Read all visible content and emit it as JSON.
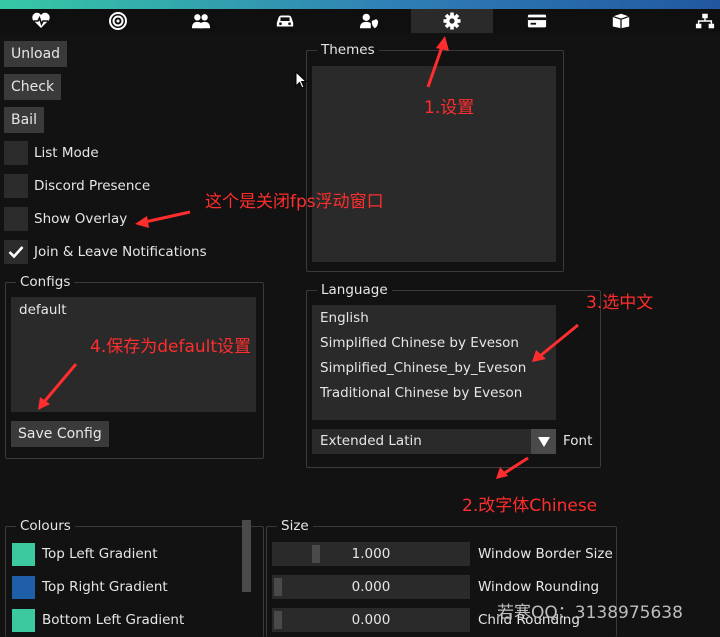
{
  "tabs": [
    {
      "name": "heartbeat-icon"
    },
    {
      "name": "target-icon"
    },
    {
      "name": "users-icon"
    },
    {
      "name": "car-icon"
    },
    {
      "name": "user-shield-icon"
    },
    {
      "name": "gear-icon",
      "active": true
    },
    {
      "name": "card-icon"
    },
    {
      "name": "box-icon"
    },
    {
      "name": "network-icon"
    }
  ],
  "buttons": {
    "unload": "Unload",
    "check": "Check",
    "bail": "Bail",
    "save_config": "Save Config"
  },
  "checkboxes": [
    {
      "label": "List Mode",
      "checked": false
    },
    {
      "label": "Discord Presence",
      "checked": false
    },
    {
      "label": "Show Overlay",
      "checked": false
    },
    {
      "label": "Join & Leave Notifications",
      "checked": true
    }
  ],
  "configs": {
    "title": "Configs",
    "items": [
      "default"
    ]
  },
  "themes": {
    "title": "Themes"
  },
  "language": {
    "title": "Language",
    "items": [
      "English",
      "Simplified Chinese by Eveson",
      "Simplified_Chinese_by_Eveson",
      "Traditional Chinese by Eveson"
    ],
    "font_value": "Extended Latin",
    "font_label": "Font"
  },
  "colours": {
    "title": "Colours",
    "items": [
      {
        "label": "Top Left Gradient",
        "color": "#3cc9a0"
      },
      {
        "label": "Top Right Gradient",
        "color": "#1f5fa8"
      },
      {
        "label": "Bottom Left Gradient",
        "color": "#3cc9a0"
      }
    ]
  },
  "size": {
    "title": "Size",
    "items": [
      {
        "label": "Window Border Size",
        "value": "1.000",
        "fraction": 0.22
      },
      {
        "label": "Window Rounding",
        "value": "0.000",
        "fraction": 0
      },
      {
        "label": "Child Rounding",
        "value": "0.000",
        "fraction": 0
      }
    ]
  },
  "annotations": {
    "settings": "1.设置",
    "change_font": "2.改字体Chinese",
    "select_chinese": "3.选中文",
    "save_default": "4.保存为default设置",
    "overlay_note": "这个是关闭fps浮动窗口"
  },
  "watermark": "若寒QQ：3138975638",
  "colors": {
    "accent_teal": "#36c9a5",
    "accent_blue": "#2157a0",
    "annotation_red": "#ff2d2d"
  }
}
